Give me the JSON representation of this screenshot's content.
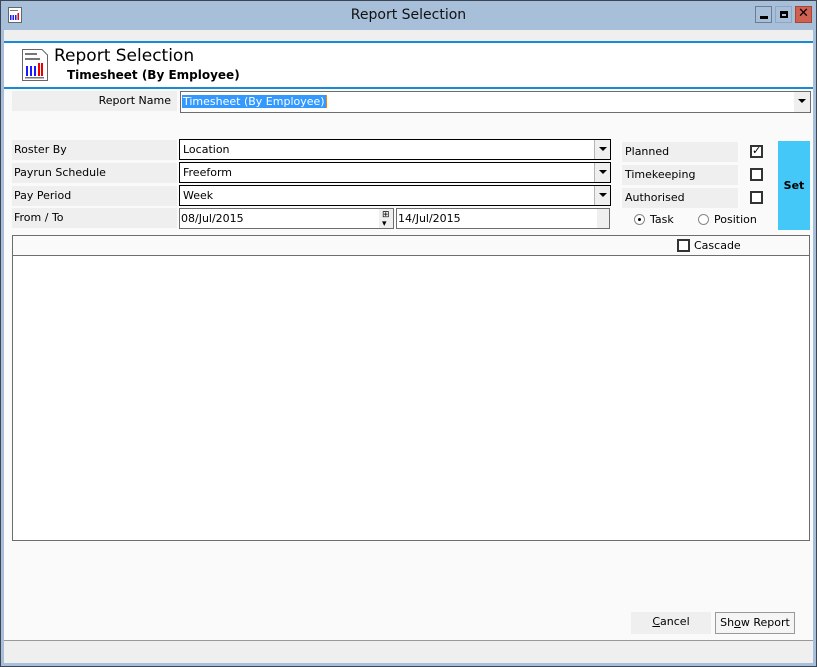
{
  "window": {
    "title": "Report Selection",
    "controls": {
      "minimize": "minimize",
      "maximize": "maximize",
      "close": "close"
    }
  },
  "header": {
    "title": "Report Selection",
    "subtitle": "Timesheet (By Employee)",
    "icon": "report-chart-icon"
  },
  "form": {
    "report_name": {
      "label": "Report Name",
      "value": "Timesheet (By Employee)"
    },
    "roster_by": {
      "label": "Roster By",
      "value": "Location"
    },
    "payrun_schedule": {
      "label": "Payrun Schedule",
      "value": "Freeform"
    },
    "pay_period": {
      "label": "Pay Period",
      "value": "Week"
    },
    "from_to": {
      "label": "From / To",
      "from": "08/Jul/2015",
      "to": "14/Jul/2015"
    }
  },
  "options": {
    "planned": {
      "label": "Planned",
      "checked": true
    },
    "timekeeping": {
      "label": "Timekeeping",
      "checked": false
    },
    "authorised": {
      "label": "Authorised",
      "checked": false
    },
    "set_label": "Set",
    "mode": {
      "task": {
        "label": "Task",
        "selected": true
      },
      "position": {
        "label": "Position",
        "selected": false
      }
    }
  },
  "tree": {
    "cascade": {
      "label": "Cascade",
      "checked": false
    }
  },
  "buttons": {
    "cancel_label_pre": "",
    "cancel_label_u": "C",
    "cancel_label_post": "ancel",
    "show_label_pre": "Sh",
    "show_label_u": "o",
    "show_label_post": "w Report"
  }
}
